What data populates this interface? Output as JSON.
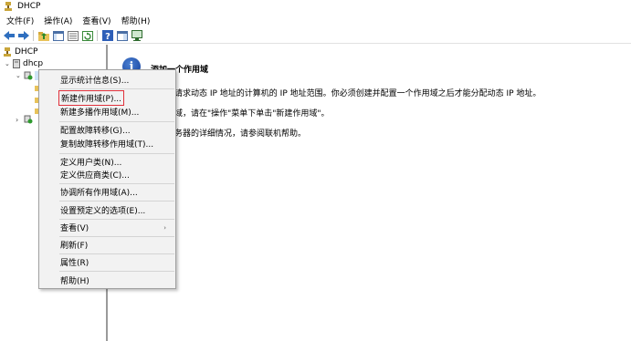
{
  "window": {
    "title": "DHCP"
  },
  "menubar": [
    "文件(F)",
    "操作(A)",
    "查看(V)",
    "帮助(H)"
  ],
  "toolbar": {
    "icons": [
      "back-icon",
      "forward-icon",
      "up-folder-icon",
      "show-hide-tree-icon",
      "properties-icon",
      "refresh-icon",
      "help-icon",
      "action-pane-icon",
      "console-icon"
    ]
  },
  "tree": {
    "root_label": "DHCP",
    "server_label": "dhcp"
  },
  "content": {
    "heading": "添加一个作用域",
    "lines": [
      "给请求动态 IP 地址的计算机的 IP 地址范围。你必须创建并配置一个作用域之后才能分配动态 IP 地址。",
      "用域，请在\"操作\"菜单下单击\"新建作用域\"。",
      "服务器的详细情况，请参阅联机帮助。"
    ]
  },
  "context_menu": {
    "items": [
      "显示统计信息(S)...",
      "新建作用域(P)...",
      "新建多播作用域(M)...",
      "配置故障转移(G)...",
      "复制故障转移作用域(T)...",
      "定义用户类(N)...",
      "定义供应商类(C)...",
      "协调所有作用域(A)...",
      "设置预定义的选项(E)...",
      "查看(V)",
      "刷新(F)",
      "属性(R)",
      "帮助(H)"
    ],
    "highlighted_index": 1
  },
  "colors": {
    "highlight_border": "#e0313b",
    "menu_bg": "#f2f2f2"
  }
}
